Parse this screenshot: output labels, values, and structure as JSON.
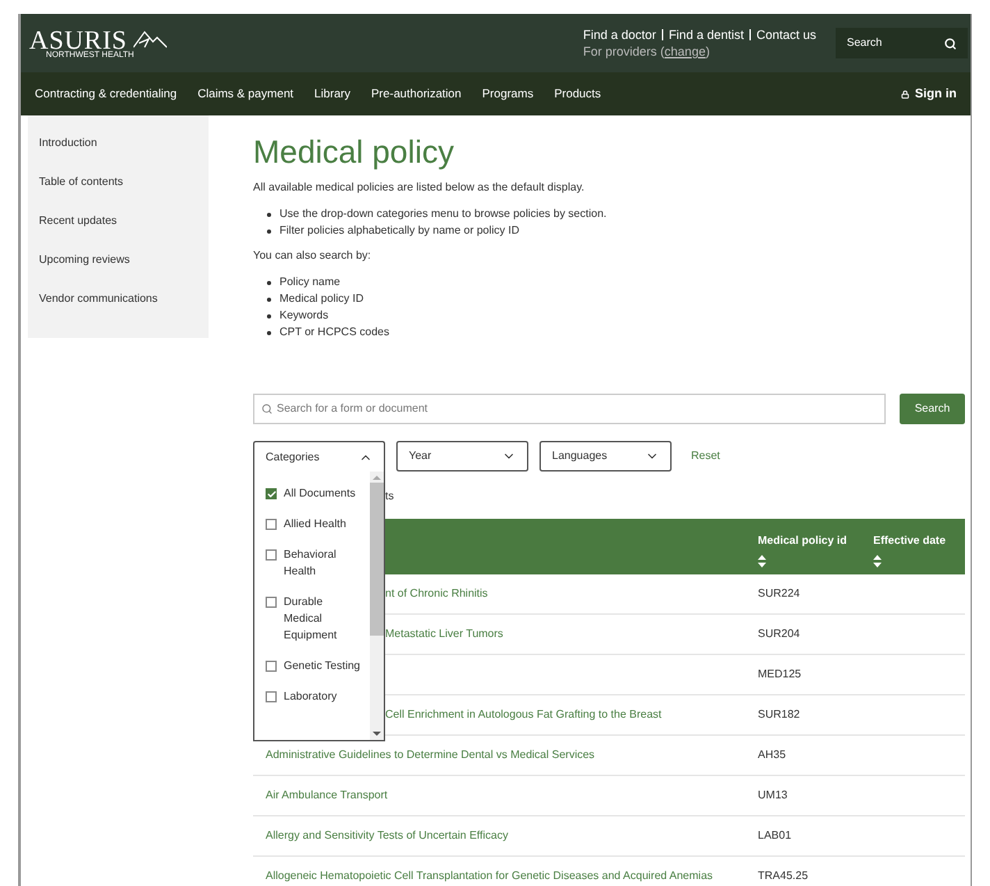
{
  "header": {
    "logo": {
      "name": "ASURIS",
      "tagline": "NORTHWEST HEALTH"
    },
    "links": [
      "Find a doctor",
      "Find a dentist",
      "Contact us"
    ],
    "providers_label": "For providers (",
    "providers_link": "change",
    "providers_end": ")",
    "search": {
      "placeholder": "Search"
    }
  },
  "nav": {
    "items": [
      "Contracting & credentialing",
      "Claims & payment",
      "Library",
      "Pre-authorization",
      "Programs",
      "Products"
    ],
    "sign_in": "Sign in"
  },
  "sidebar": {
    "items": [
      "Introduction",
      "Table of contents",
      "Recent updates",
      "Upcoming reviews",
      "Vendor communications"
    ]
  },
  "page": {
    "title": "Medical policy",
    "intro": "All available medical policies are listed below as the default display.",
    "bullets": [
      "Use the drop-down categories menu to browse policies by section.",
      "Filter policies alphabetically by name or policy ID"
    ],
    "search_by_label": "You can also search by:",
    "search_by": [
      "Policy name",
      "Medical policy ID",
      "Keywords",
      "CPT or HCPCS codes"
    ]
  },
  "search": {
    "placeholder": "Search for a form or document",
    "button": "Search"
  },
  "filters": [
    {
      "label": "Categories",
      "expanded": true
    },
    {
      "label": "Year",
      "expanded": false
    },
    {
      "label": "Languages",
      "expanded": false
    }
  ],
  "reset": "Reset",
  "categories_menu": [
    {
      "label": "All Documents",
      "checked": true
    },
    {
      "label": "Allied Health",
      "checked": false
    },
    {
      "label": "Behavioral Health",
      "checked": false
    },
    {
      "label": "Durable Medical Equipment",
      "checked": false
    },
    {
      "label": "Genetic Testing",
      "checked": false
    },
    {
      "label": "Laboratory",
      "checked": false
    }
  ],
  "results_fragment": "ts",
  "table": {
    "columns": [
      "Medical policy id",
      "Effective date"
    ],
    "rows": [
      {
        "title": "nt of Chronic Rhinitis",
        "id": "SUR224",
        "partly_hidden": true
      },
      {
        "title": "Metastatic Liver Tumors",
        "id": "SUR204",
        "partly_hidden": true
      },
      {
        "id": "MED125"
      },
      {
        "title": "Cell Enrichment in Autologous Fat Grafting to the Breast",
        "id": "SUR182",
        "partly_hidden": true
      },
      {
        "title": "Administrative Guidelines to Determine Dental vs Medical Services",
        "id": "AH35",
        "partly_hidden": false
      },
      {
        "title": "Air Ambulance Transport",
        "id": "UM13",
        "partly_hidden": false
      },
      {
        "title": "Allergy and Sensitivity Tests of Uncertain Efficacy",
        "id": "LAB01",
        "partly_hidden": false
      },
      {
        "title": "Allogeneic Hematopoietic Cell Transplantation for Genetic Diseases and Acquired Anemias",
        "id": "TRA45.25",
        "partly_hidden": false
      }
    ]
  }
}
